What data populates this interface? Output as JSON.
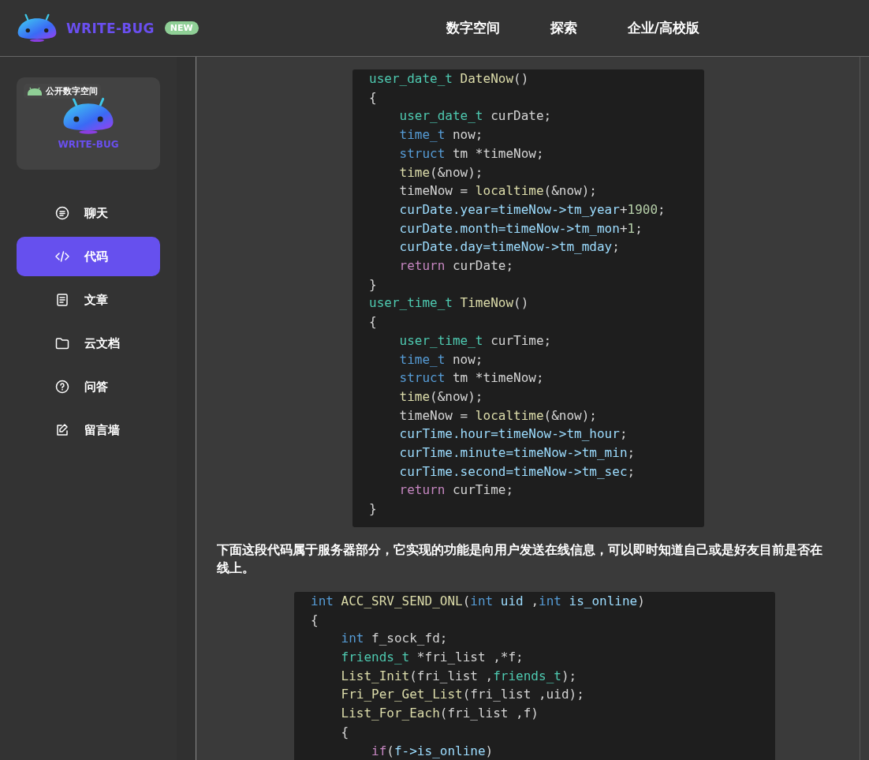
{
  "header": {
    "brand": "WRITE-BUG",
    "badge": "NEW",
    "nav": [
      {
        "label": "数字空间",
        "selected": false
      },
      {
        "label": "探索",
        "selected": false
      },
      {
        "label": "企业/高校版",
        "selected": false
      }
    ]
  },
  "sidebar": {
    "space_card": {
      "tag": "公开数字空间",
      "name": "WRITE-BUG"
    },
    "items": [
      {
        "label": "聊天",
        "kind": "chat",
        "selected": false
      },
      {
        "label": "代码",
        "kind": "code",
        "selected": true
      },
      {
        "label": "文章",
        "kind": "article",
        "selected": false
      },
      {
        "label": "云文档",
        "kind": "folder",
        "selected": false
      },
      {
        "label": "问答",
        "kind": "question",
        "selected": false
      },
      {
        "label": "留言墙",
        "kind": "edit",
        "selected": false
      }
    ]
  },
  "content": [
    {
      "kind": "code",
      "lines": [
        [
          {
            "t": "user_date_t",
            "kind": "type"
          },
          {
            "t": " DateNow",
            "kind": "func"
          },
          {
            "t": "()",
            "kind": "plain"
          }
        ],
        [
          {
            "t": "{",
            "kind": "plain"
          }
        ],
        [
          {
            "t": "    user_date_t",
            "kind": "type"
          },
          {
            "t": " curDate;",
            "kind": "plain"
          }
        ],
        [
          {
            "t": "    time_t",
            "kind": "keyword"
          },
          {
            "t": " now;",
            "kind": "plain"
          }
        ],
        [
          {
            "t": "    struct",
            "kind": "keyword"
          },
          {
            "t": " tm *timeNow;",
            "kind": "plain"
          }
        ],
        [
          {
            "t": "    time",
            "kind": "func"
          },
          {
            "t": "(&now);",
            "kind": "plain"
          }
        ],
        [
          {
            "t": "    timeNow = ",
            "kind": "plain"
          },
          {
            "t": "localtime",
            "kind": "func"
          },
          {
            "t": "(&now);",
            "kind": "plain"
          }
        ],
        [
          {
            "t": "    curDate.year=timeNow->tm_year",
            "kind": "var"
          },
          {
            "t": "+",
            "kind": "plain"
          },
          {
            "t": "1900",
            "kind": "num"
          },
          {
            "t": ";",
            "kind": "plain"
          }
        ],
        [
          {
            "t": "    curDate.month=timeNow->tm_mon",
            "kind": "var"
          },
          {
            "t": "+",
            "kind": "plain"
          },
          {
            "t": "1",
            "kind": "num"
          },
          {
            "t": ";",
            "kind": "plain"
          }
        ],
        [
          {
            "t": "    curDate.day=timeNow->tm_mday",
            "kind": "var"
          },
          {
            "t": ";",
            "kind": "plain"
          }
        ],
        [
          {
            "t": "    return",
            "kind": "control"
          },
          {
            "t": " curDate;",
            "kind": "plain"
          }
        ],
        [
          {
            "t": "}",
            "kind": "plain"
          }
        ],
        [
          {
            "t": "user_time_t",
            "kind": "type"
          },
          {
            "t": " TimeNow",
            "kind": "func"
          },
          {
            "t": "()",
            "kind": "plain"
          }
        ],
        [
          {
            "t": "{",
            "kind": "plain"
          }
        ],
        [
          {
            "t": "    user_time_t",
            "kind": "type"
          },
          {
            "t": " curTime;",
            "kind": "plain"
          }
        ],
        [
          {
            "t": "    time_t",
            "kind": "keyword"
          },
          {
            "t": " now;",
            "kind": "plain"
          }
        ],
        [
          {
            "t": "    struct",
            "kind": "keyword"
          },
          {
            "t": " tm *timeNow;",
            "kind": "plain"
          }
        ],
        [
          {
            "t": "    time",
            "kind": "func"
          },
          {
            "t": "(&now);",
            "kind": "plain"
          }
        ],
        [
          {
            "t": "    timeNow = ",
            "kind": "plain"
          },
          {
            "t": "localtime",
            "kind": "func"
          },
          {
            "t": "(&now);",
            "kind": "plain"
          }
        ],
        [
          {
            "t": "    curTime.hour=timeNow->tm_hour",
            "kind": "var"
          },
          {
            "t": ";",
            "kind": "plain"
          }
        ],
        [
          {
            "t": "    curTime.minute=timeNow->tm_min",
            "kind": "var"
          },
          {
            "t": ";",
            "kind": "plain"
          }
        ],
        [
          {
            "t": "    curTime.second=timeNow->tm_sec",
            "kind": "var"
          },
          {
            "t": ";",
            "kind": "plain"
          }
        ],
        [
          {
            "t": "    return",
            "kind": "control"
          },
          {
            "t": " curTime;",
            "kind": "plain"
          }
        ],
        [
          {
            "t": "}",
            "kind": "plain"
          }
        ]
      ]
    },
    {
      "kind": "paragraph",
      "text": "下面这段代码属于服务器部分，它实现的功能是向用户发送在线信息，可以即时知道自己或是好友目前是否在线上。"
    },
    {
      "kind": "code",
      "lines": [
        [
          {
            "t": "int",
            "kind": "keyword"
          },
          {
            "t": " ACC_SRV_SEND_ONL",
            "kind": "func"
          },
          {
            "t": "(",
            "kind": "plain"
          },
          {
            "t": "int",
            "kind": "keyword"
          },
          {
            "t": " uid",
            "kind": "var"
          },
          {
            "t": " ,",
            "kind": "plain"
          },
          {
            "t": "int",
            "kind": "keyword"
          },
          {
            "t": " is_online",
            "kind": "var"
          },
          {
            "t": ")",
            "kind": "plain"
          }
        ],
        [
          {
            "t": "{",
            "kind": "plain"
          }
        ],
        [
          {
            "t": "    int",
            "kind": "keyword"
          },
          {
            "t": " f_sock_fd;",
            "kind": "plain"
          }
        ],
        [
          {
            "t": "    friends_t",
            "kind": "type"
          },
          {
            "t": " *fri_list ,*f;",
            "kind": "plain"
          }
        ],
        [
          {
            "t": "    List_Init",
            "kind": "func"
          },
          {
            "t": "(fri_list ,",
            "kind": "plain"
          },
          {
            "t": "friends_t",
            "kind": "type"
          },
          {
            "t": ");",
            "kind": "plain"
          }
        ],
        [
          {
            "t": "    Fri_Per_Get_List",
            "kind": "func"
          },
          {
            "t": "(fri_list ,uid);",
            "kind": "plain"
          }
        ],
        [
          {
            "t": "    List_For_Each",
            "kind": "func"
          },
          {
            "t": "(fri_list ,f)",
            "kind": "plain"
          }
        ],
        [
          {
            "t": "    {",
            "kind": "plain"
          }
        ],
        [
          {
            "t": "        if",
            "kind": "control"
          },
          {
            "t": "(",
            "kind": "plain"
          },
          {
            "t": "f->is_online",
            "kind": "var"
          },
          {
            "t": ")",
            "kind": "plain"
          }
        ]
      ]
    }
  ]
}
